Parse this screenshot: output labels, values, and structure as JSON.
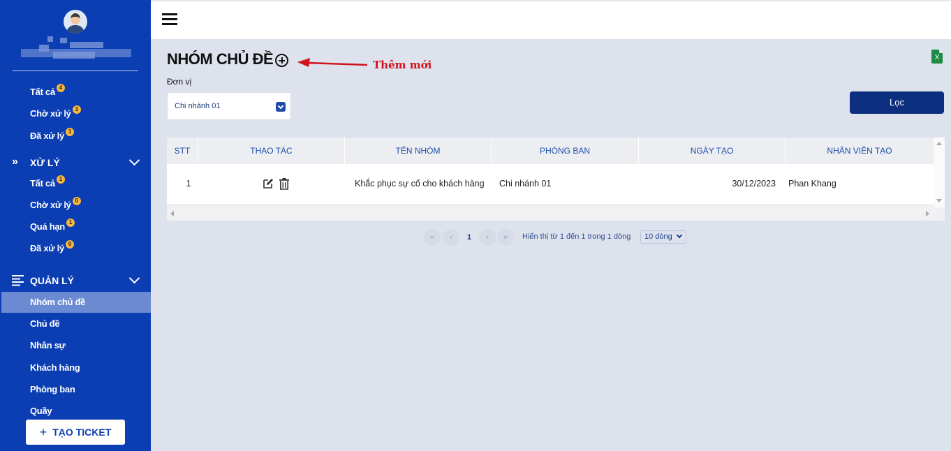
{
  "sidebar": {
    "group_all": [
      {
        "label": "Tất cả",
        "badge": "4"
      },
      {
        "label": "Chờ xử lý",
        "badge": "3"
      },
      {
        "label": "Đã xử lý",
        "badge": "1"
      }
    ],
    "section_process": {
      "title": "XỬ LÝ",
      "items": [
        {
          "label": "Tất cả",
          "badge": "1"
        },
        {
          "label": "Chờ xử lý",
          "badge": "0"
        },
        {
          "label": "Quá hạn",
          "badge": "1"
        },
        {
          "label": "Đã xử lý",
          "badge": "0"
        }
      ]
    },
    "section_manage": {
      "title": "QUẢN LÝ",
      "items": [
        {
          "label": "Nhóm chủ đề",
          "active": true
        },
        {
          "label": "Chủ đề"
        },
        {
          "label": "Nhân sự"
        },
        {
          "label": "Khách hàng"
        },
        {
          "label": "Phòng ban"
        },
        {
          "label": "Quầy"
        }
      ]
    },
    "create_button": "TẠO TICKET"
  },
  "header": {
    "page_title": "NHÓM CHỦ ĐỀ",
    "annotation": "Thêm mới",
    "excel_icon_letter": "X"
  },
  "filter": {
    "unit_label": "Đơn vị",
    "unit_value": "Chi nhánh 01",
    "filter_button": "Lọc"
  },
  "table": {
    "columns": [
      "STT",
      "THAO TÁC",
      "TÊN NHÓM",
      "PHÒNG BAN",
      "NGÀY TẠO",
      "NHÂN VIÊN TẠO"
    ],
    "rows": [
      {
        "stt": "1",
        "name": "Khắc phục sự cố cho khách hàng",
        "department": "Chi nhánh 01",
        "created_date": "30/12/2023",
        "created_by": "Phan Khang"
      }
    ]
  },
  "pagination": {
    "first": "«",
    "prev": "‹",
    "page": "1",
    "next": "›",
    "last": "»",
    "summary": "Hiển thị từ 1 đến 1 trong 1 dòng",
    "page_size": "10 dòng"
  },
  "colors": {
    "sidebar_bg": "#0b3db3",
    "sidebar_active": "#6b8ad1",
    "badge": "#f6b73c",
    "content_bg": "#dde2ed",
    "primary_button": "#0d2f80",
    "annotation_red": "#d0121b",
    "excel_green": "#1f8b45"
  }
}
